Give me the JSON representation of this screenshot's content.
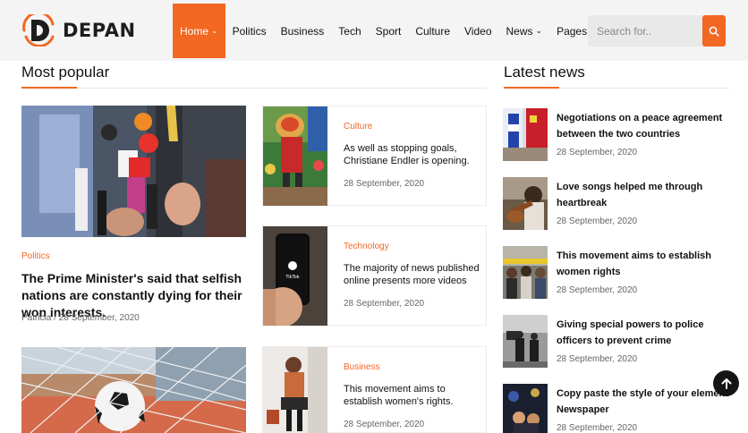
{
  "brand": {
    "name": "DEPAN",
    "accent": "#f26722"
  },
  "nav": {
    "items": [
      {
        "label": "Home",
        "dropdown": true,
        "active": true
      },
      {
        "label": "Politics"
      },
      {
        "label": "Business"
      },
      {
        "label": "Tech"
      },
      {
        "label": "Sport"
      },
      {
        "label": "Culture"
      },
      {
        "label": "Video"
      },
      {
        "label": "News",
        "dropdown": true
      },
      {
        "label": "Pages",
        "dropdown": true
      }
    ],
    "chevron": "⌄"
  },
  "search": {
    "placeholder": "Search for..",
    "icon": "search-icon"
  },
  "most_popular": {
    "heading": "Most popular",
    "featured": {
      "category": "Politics",
      "title": "The Prime Minister's said that selfish nations are constantly dying for their won interests.",
      "meta": "Patricia / 28 September, 2020"
    },
    "side_cards": [
      {
        "category": "Culture",
        "title": "As well as stopping goals, Christiane Endler is opening.",
        "date": "28 September, 2020"
      },
      {
        "category": "Technology",
        "title": "The majority of news published online presents more videos",
        "date": "28 September, 2020"
      },
      {
        "category": "Business",
        "title": "This movement aims to establish women's rights.",
        "date": "28 September, 2020"
      }
    ]
  },
  "latest_news": {
    "heading": "Latest news",
    "items": [
      {
        "title": "Negotiations on a peace agreement between the two countries",
        "date": "28 September, 2020"
      },
      {
        "title": "Love songs helped me through heartbreak",
        "date": "28 September, 2020"
      },
      {
        "title": "This movement aims to establish women rights",
        "date": "28 September, 2020"
      },
      {
        "title": "Giving special powers to police officers to prevent crime",
        "date": "28 September, 2020"
      },
      {
        "title": "Copy paste the style of your element Newspaper",
        "date": "28 September, 2020"
      }
    ]
  },
  "scroll_top": {
    "icon": "arrow-up-icon"
  }
}
